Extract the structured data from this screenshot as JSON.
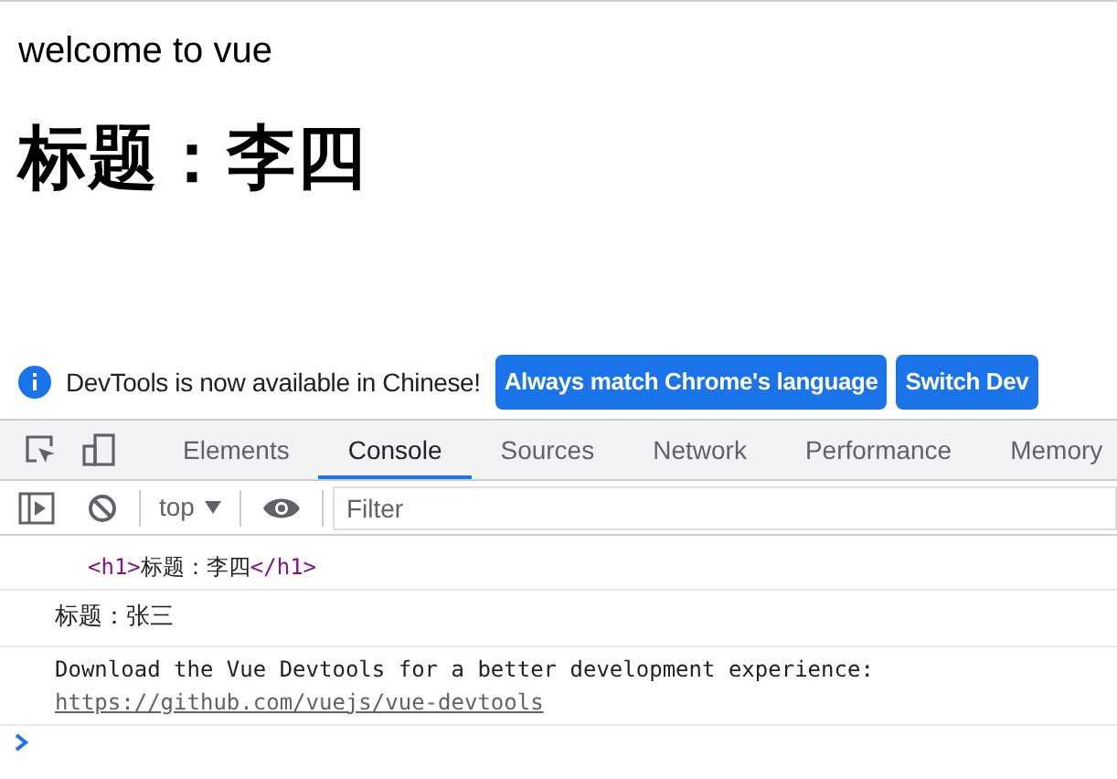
{
  "page": {
    "text": "welcome to vue",
    "heading": "标题：李四"
  },
  "infobar": {
    "message": "DevTools is now available in Chinese!",
    "buttons": [
      "Always match Chrome's language",
      "Switch Dev"
    ]
  },
  "tabs": [
    {
      "label": "Elements",
      "selected": false
    },
    {
      "label": "Console",
      "selected": true
    },
    {
      "label": "Sources",
      "selected": false
    },
    {
      "label": "Network",
      "selected": false
    },
    {
      "label": "Performance",
      "selected": false
    },
    {
      "label": "Memory",
      "selected": false
    }
  ],
  "console_toolbar": {
    "context": "top",
    "filter_placeholder": "Filter"
  },
  "console": [
    {
      "kind": "element",
      "open_tag": "<h1>",
      "text": "标题：李四",
      "close_tag": "</h1>"
    },
    {
      "kind": "log",
      "text": "标题：张三"
    },
    {
      "kind": "log",
      "text": "Download the Vue Devtools for a better development experience:",
      "link": "https://github.com/vuejs/vue-devtools"
    }
  ]
}
